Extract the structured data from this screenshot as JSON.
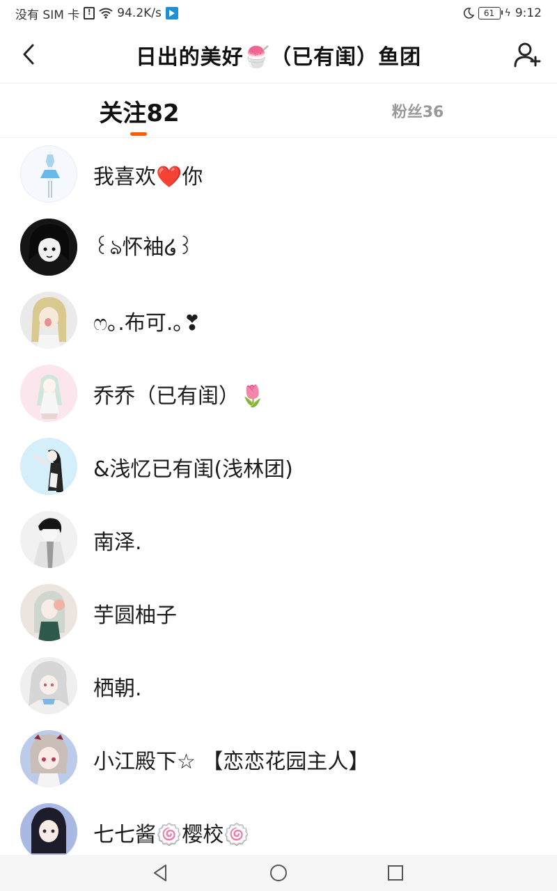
{
  "status_bar": {
    "carrier": "没有 SIM 卡",
    "speed": "94.2K/s",
    "battery": "61",
    "time": "9:12"
  },
  "header": {
    "title": "日出的美好🍧（已有闺）鱼团"
  },
  "tabs": {
    "following_label": "关注82",
    "fans_label": "粉丝36"
  },
  "following": [
    {
      "name": "我喜欢❤️你"
    },
    {
      "name": "꒰ঌ怀袖໒꒱"
    },
    {
      "name": "ෆ｡.布可.｡❣"
    },
    {
      "name": "乔乔（已有闺）🌷"
    },
    {
      "name": "&浅忆已有闺(浅林团)"
    },
    {
      "name": "南泽."
    },
    {
      "name": "芋圆柚子"
    },
    {
      "name": "栖朝."
    },
    {
      "name": "小江殿下☆ 【恋恋花园主人】"
    },
    {
      "name": "七七酱🍥樱校🍥"
    }
  ],
  "icons": {
    "back": "chevron-left-icon",
    "add_user": "add-user-icon",
    "nav_back": "triangle-back-icon",
    "nav_home": "circle-home-icon",
    "nav_recents": "square-recents-icon"
  },
  "colors": {
    "accent": "#ff5a00",
    "tab_inactive": "#999999",
    "text": "#1c1c1c",
    "nav_bg": "#f6f6f6"
  }
}
